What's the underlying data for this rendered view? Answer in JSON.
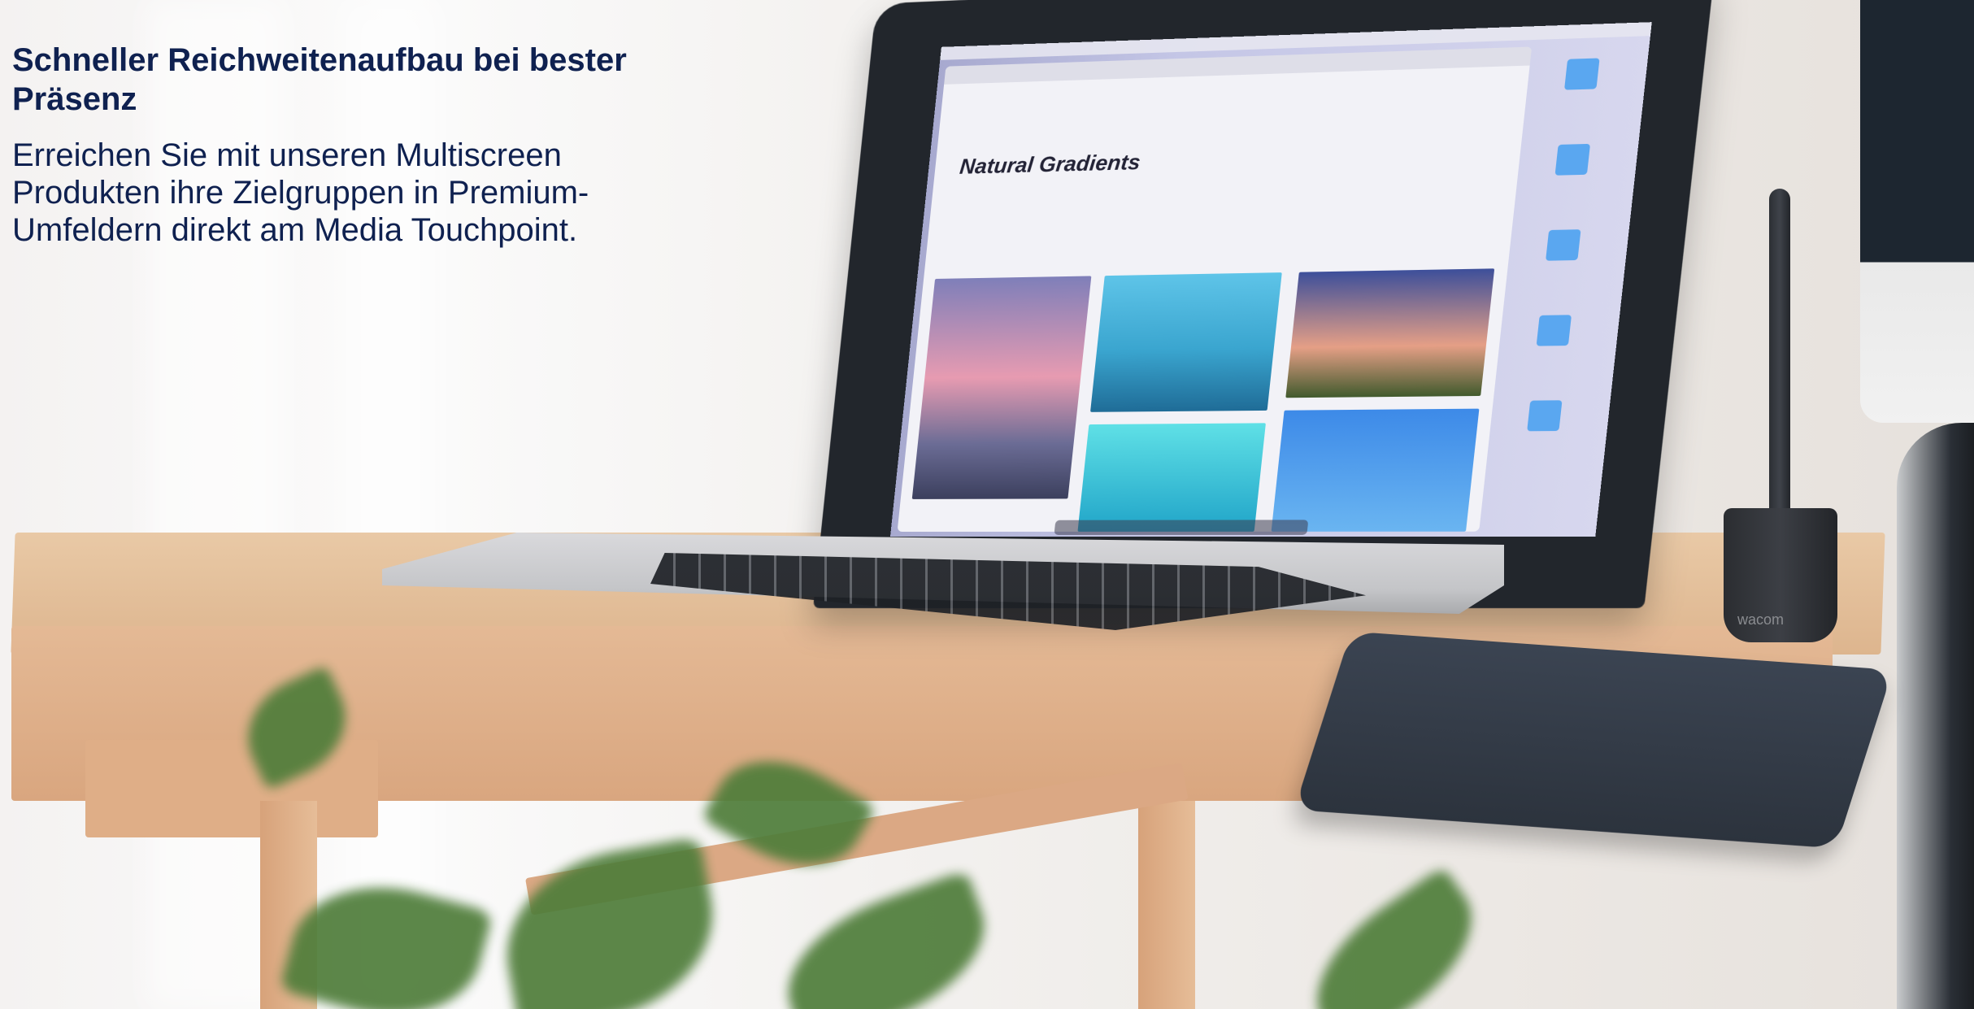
{
  "hero": {
    "title": "Schneller Reichweitenaufbau bei bester Präsenz",
    "body": "Erreichen Sie mit unseren Multiscreen Produkten ihre Zielgruppen in Premium-Umfeldern direkt am Media Touchpoint."
  },
  "background_photo": {
    "laptop_screen_heading": "Natural Gradients",
    "pen_holder_label": "wacom"
  },
  "colors": {
    "text": "#0f2150",
    "desk": "#ddb58e",
    "laptop": "#22262c",
    "plant": "#4f7d3a"
  }
}
